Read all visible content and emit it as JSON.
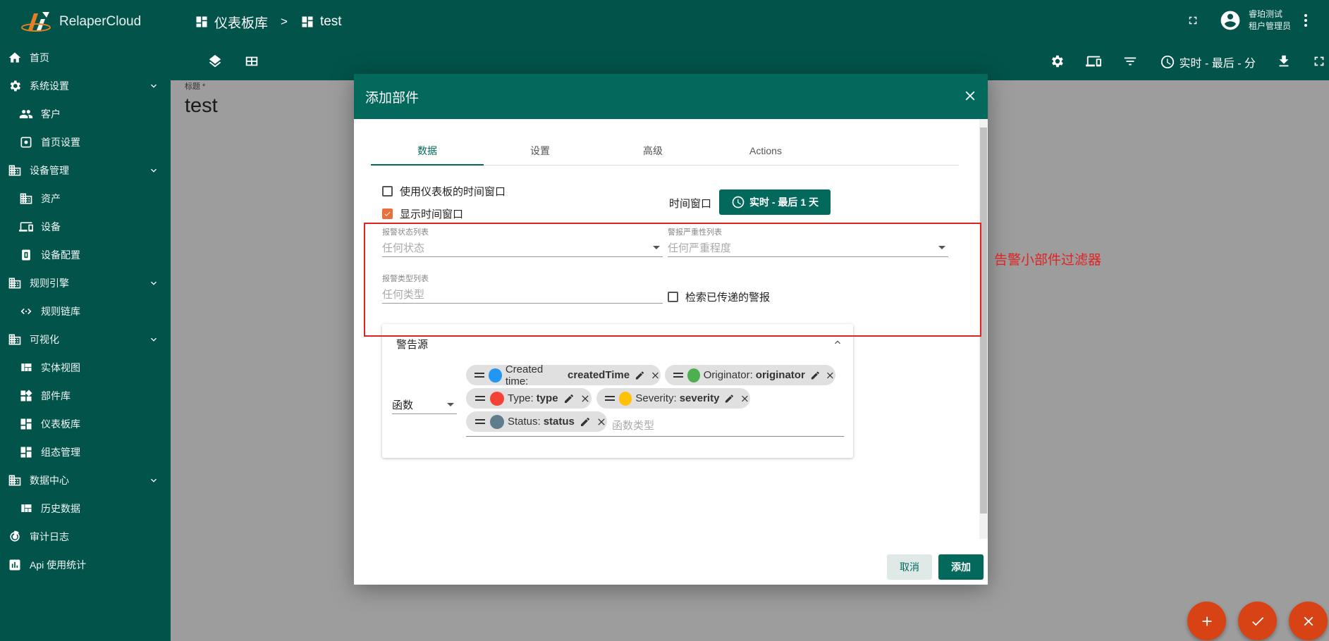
{
  "app": {
    "brand": "RelaperCloud"
  },
  "breadcrumb": {
    "root": "仪表板库",
    "separator": ">",
    "current": "test"
  },
  "user": {
    "name": "睿珀测试",
    "role": "租户管理员"
  },
  "sidebar": {
    "items": [
      {
        "label": "首页",
        "icon": "home-icon",
        "sub": false,
        "chevron": false
      },
      {
        "label": "系统设置",
        "icon": "gear-icon",
        "sub": false,
        "chevron": true
      },
      {
        "label": "客户",
        "icon": "people-icon",
        "sub": true,
        "chevron": false
      },
      {
        "label": "首页设置",
        "icon": "settings-box-icon",
        "sub": true,
        "chevron": false
      },
      {
        "label": "设备管理",
        "icon": "building-icon",
        "sub": false,
        "chevron": true
      },
      {
        "label": "资产",
        "icon": "building-icon",
        "sub": true,
        "chevron": false
      },
      {
        "label": "设备",
        "icon": "devices-icon",
        "sub": true,
        "chevron": false
      },
      {
        "label": "设备配置",
        "icon": "device-profile-icon",
        "sub": true,
        "chevron": false
      },
      {
        "label": "规则引擎",
        "icon": "building-icon",
        "sub": false,
        "chevron": true
      },
      {
        "label": "规则链库",
        "icon": "code-arrows-icon",
        "sub": true,
        "chevron": false
      },
      {
        "label": "可视化",
        "icon": "building-icon",
        "sub": false,
        "chevron": true
      },
      {
        "label": "实体视图",
        "icon": "view-quilt-icon",
        "sub": true,
        "chevron": false
      },
      {
        "label": "部件库",
        "icon": "widgets-icon",
        "sub": true,
        "chevron": false
      },
      {
        "label": "仪表板库",
        "icon": "dashboard-icon",
        "sub": true,
        "chevron": false
      },
      {
        "label": "组态管理",
        "icon": "dashboard-icon",
        "sub": true,
        "chevron": false
      },
      {
        "label": "数据中心",
        "icon": "building-icon",
        "sub": false,
        "chevron": true
      },
      {
        "label": "历史数据",
        "icon": "view-quilt-icon",
        "sub": true,
        "chevron": false
      },
      {
        "label": "审计日志",
        "icon": "track-changes-icon",
        "sub": false,
        "chevron": false
      },
      {
        "label": "Api 使用统计",
        "icon": "chart-icon",
        "sub": false,
        "chevron": false
      }
    ]
  },
  "toolbar": {
    "time_label": "实时 - 最后 - 分"
  },
  "dashboard": {
    "title_label": "标题 *",
    "title": "test"
  },
  "dialog": {
    "title": "添加部件",
    "tabs": [
      "数据",
      "设置",
      "高级",
      "Actions"
    ],
    "active_tab": "数据",
    "use_dashboard_timewindow": {
      "label": "使用仪表板的时间窗口",
      "checked": false
    },
    "display_timewindow": {
      "label": "显示时间窗口",
      "checked": true
    },
    "timewindow_label": "时间窗口",
    "timewindow_value": "实时 - 最后 1 天",
    "alarm_status": {
      "label": "报警状态列表",
      "placeholder": "任何状态"
    },
    "alarm_severity": {
      "label": "警报严重性列表",
      "placeholder": "任何严重程度"
    },
    "alarm_type": {
      "label": "报警类型列表",
      "placeholder": "任何类型"
    },
    "search_propagated": {
      "label": "检索已传递的警报",
      "checked": false
    },
    "annotation": "告警小部件过滤器",
    "alarm_source": {
      "title": "警告源",
      "type_value": "函数",
      "keys": [
        {
          "label": "Created time:",
          "key": "createdTime",
          "color": "#2196f3"
        },
        {
          "label": "Originator:",
          "key": "originator",
          "color": "#4caf50"
        },
        {
          "label": "Type:",
          "key": "type",
          "color": "#f44336"
        },
        {
          "label": "Severity:",
          "key": "severity",
          "color": "#ffc107"
        },
        {
          "label": "Status:",
          "key": "status",
          "color": "#607d8b"
        }
      ],
      "keys_placeholder": "函数类型"
    },
    "cancel": "取消",
    "add": "添加"
  },
  "colors": {
    "primary": "#02534a",
    "header": "#02695c",
    "fab": "#d84315",
    "annotation": "#e02222",
    "check": "#e8703a"
  }
}
